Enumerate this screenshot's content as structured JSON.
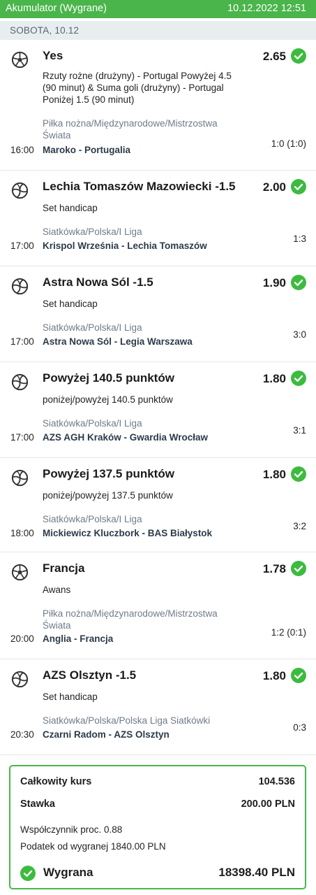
{
  "header": {
    "title": "Akumulator (Wygrane)",
    "datetime": "10.12.2022 12:51",
    "bg": "#49b54a"
  },
  "day": {
    "label": "SOBOTA, 10.12"
  },
  "bets": [
    {
      "sport": "football",
      "selection": "Yes",
      "odds": "2.65",
      "market": "Rzuty rożne (drużyny) - Portugal Powyżej 4.5 (90 minut) & Suma goli (drużyny) - Portugal Poniżej 1.5 (90 minut)",
      "category": "Piłka nożna/Międzynarodowe/Mistrzostwa Świata",
      "time": "16:00",
      "teams": "Maroko - Portugalia",
      "score": "1:0 (1:0)"
    },
    {
      "sport": "volleyball",
      "selection": "Lechia Tomaszów Mazowiecki -1.5",
      "odds": "2.00",
      "market": "Set handicap",
      "category": "Siatkówka/Polska/I Liga",
      "time": "17:00",
      "teams": "Krispol Września - Lechia Tomaszów",
      "score": "1:3"
    },
    {
      "sport": "volleyball",
      "selection": "Astra Nowa Sól -1.5",
      "odds": "1.90",
      "market": "Set handicap",
      "category": "Siatkówka/Polska/I Liga",
      "time": "17:00",
      "teams": "Astra Nowa Sól - Legia Warszawa",
      "score": "3:0"
    },
    {
      "sport": "volleyball",
      "selection": "Powyżej 140.5 punktów",
      "odds": "1.80",
      "market": "poniżej/powyżej 140.5 punktów",
      "category": "Siatkówka/Polska/I Liga",
      "time": "17:00",
      "teams": "AZS AGH Kraków - Gwardia Wrocław",
      "score": "3:1"
    },
    {
      "sport": "volleyball",
      "selection": "Powyżej 137.5 punktów",
      "odds": "1.80",
      "market": "poniżej/powyżej 137.5 punktów",
      "category": "Siatkówka/Polska/I Liga",
      "time": "18:00",
      "teams": "Mickiewicz Kluczbork - BAS Białystok",
      "score": "3:2"
    },
    {
      "sport": "football",
      "selection": "Francja",
      "odds": "1.78",
      "market": "Awans",
      "category": "Piłka nożna/Międzynarodowe/Mistrzostwa Świata",
      "time": "20:00",
      "teams": "Anglia - Francja",
      "score": "1:2 (0:1)"
    },
    {
      "sport": "volleyball",
      "selection": "AZS Olsztyn -1.5",
      "odds": "1.80",
      "market": "Set handicap",
      "category": "Siatkówka/Polska/Polska Liga Siatkówki",
      "time": "20:30",
      "teams": "Czarni Radom - AZS Olsztyn",
      "score": "0:3"
    }
  ],
  "summary": {
    "total_odds_label": "Całkowity kurs",
    "total_odds": "104.536",
    "stake_label": "Stawka",
    "stake": "200.00 PLN",
    "coef_label": "Współczynnik proc. 0.88",
    "tax_label": "Podatek od wygranej 1840.00 PLN",
    "win_label": "Wygrana",
    "win_amount": "18398.40 PLN"
  },
  "colors": {
    "accent": "#49b54a",
    "check": "#3cbb3f"
  },
  "icons": {
    "won": "check-circle-icon",
    "football": "football-icon",
    "volleyball": "volleyball-icon"
  }
}
